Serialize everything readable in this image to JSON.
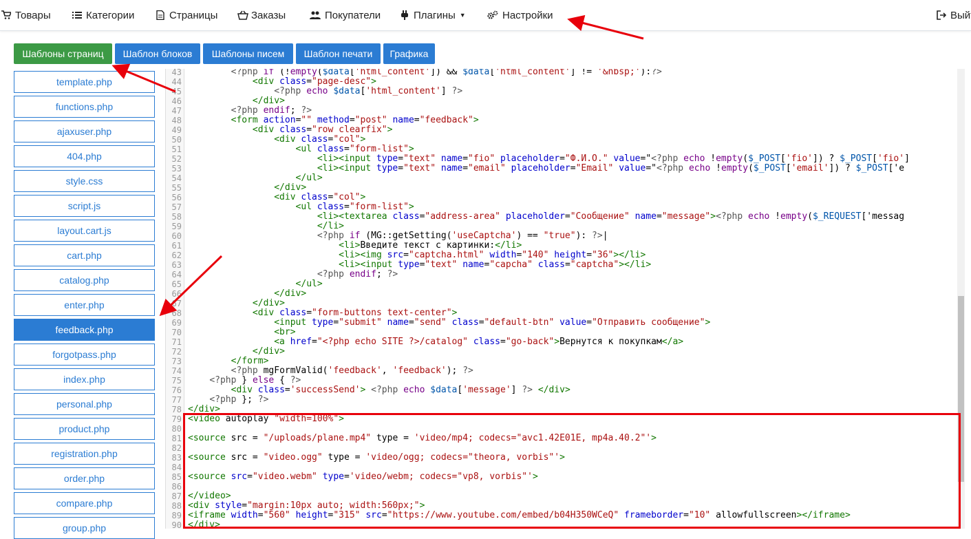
{
  "nav": {
    "items": [
      {
        "label": "Товары",
        "icon": "cart-icon"
      },
      {
        "label": "Категории",
        "icon": "list-icon"
      },
      {
        "label": "Страницы",
        "icon": "document-icon"
      },
      {
        "label": "Заказы",
        "icon": "basket-icon"
      },
      {
        "label": "Покупатели",
        "icon": "users-icon"
      },
      {
        "label": "Плагины",
        "icon": "plug-icon"
      },
      {
        "label": "Настройки",
        "icon": "gears-icon"
      }
    ],
    "exit_label": "Выйт"
  },
  "subtabs": [
    {
      "label": "Шаблоны страниц"
    },
    {
      "label": "Шаблон блоков"
    },
    {
      "label": "Шаблоны писем"
    },
    {
      "label": "Шаблон печати"
    },
    {
      "label": "Графика"
    }
  ],
  "files": [
    {
      "label": "template.php"
    },
    {
      "label": "functions.php"
    },
    {
      "label": "ajaxuser.php"
    },
    {
      "label": "404.php"
    },
    {
      "label": "style.css"
    },
    {
      "label": "script.js"
    },
    {
      "label": "layout.cart.js"
    },
    {
      "label": "cart.php"
    },
    {
      "label": "catalog.php"
    },
    {
      "label": "enter.php"
    },
    {
      "label": "feedback.php"
    },
    {
      "label": "forgotpass.php"
    },
    {
      "label": "index.php"
    },
    {
      "label": "personal.php"
    },
    {
      "label": "product.php"
    },
    {
      "label": "registration.php"
    },
    {
      "label": "order.php"
    },
    {
      "label": "compare.php"
    },
    {
      "label": "group.php"
    }
  ],
  "code": [
    {
      "n": "43",
      "t": "        <?php if (!empty($data['html_content']) && $data['html_content'] != '&nbsp;'):?>"
    },
    {
      "n": "44",
      "t": "            <div class=\"page-desc\">"
    },
    {
      "n": "45",
      "t": "                <?php echo $data['html_content'] ?>"
    },
    {
      "n": "46",
      "t": "            </div>"
    },
    {
      "n": "47",
      "t": "        <?php endif; ?>"
    },
    {
      "n": "48",
      "t": "        <form action=\"\" method=\"post\" name=\"feedback\">"
    },
    {
      "n": "49",
      "t": "            <div class=\"row clearfix\">"
    },
    {
      "n": "50",
      "t": "                <div class=\"col\">"
    },
    {
      "n": "51",
      "t": "                    <ul class=\"form-list\">"
    },
    {
      "n": "52",
      "t": "                        <li><input type=\"text\" name=\"fio\" placeholder=\"Ф.И.О.\" value=\"<?php echo !empty($_POST['fio']) ? $_POST['fio']"
    },
    {
      "n": "53",
      "t": "                        <li><input type=\"text\" name=\"email\" placeholder=\"Email\" value=\"<?php echo !empty($_POST['email']) ? $_POST['e"
    },
    {
      "n": "54",
      "t": "                    </ul>"
    },
    {
      "n": "55",
      "t": "                </div>"
    },
    {
      "n": "56",
      "t": "                <div class=\"col\">"
    },
    {
      "n": "57",
      "t": "                    <ul class=\"form-list\">"
    },
    {
      "n": "58",
      "t": "                        <li><textarea class=\"address-area\" placeholder=\"Сообщение\" name=\"message\"><?php echo !empty($_REQUEST['messag"
    },
    {
      "n": "59",
      "t": "                        </li>"
    },
    {
      "n": "60",
      "t": "                        <?php if (MG::getSetting('useCaptcha') == \"true\"): ?>|"
    },
    {
      "n": "61",
      "t": "                            <li>Введите текст с картинки:</li>"
    },
    {
      "n": "62",
      "t": "                            <li><img src=\"captcha.html\" width=\"140\" height=\"36\"></li>"
    },
    {
      "n": "63",
      "t": "                            <li><input type=\"text\" name=\"capcha\" class=\"captcha\"></li>"
    },
    {
      "n": "64",
      "t": "                        <?php endif; ?>"
    },
    {
      "n": "65",
      "t": "                    </ul>"
    },
    {
      "n": "66",
      "t": "                </div>"
    },
    {
      "n": "67",
      "t": "            </div>"
    },
    {
      "n": "68",
      "t": "            <div class=\"form-buttons text-center\">"
    },
    {
      "n": "69",
      "t": "                <input type=\"submit\" name=\"send\" class=\"default-btn\" value=\"Отправить сообщение\">"
    },
    {
      "n": "70",
      "t": "                <br>"
    },
    {
      "n": "71",
      "t": "                <a href=\"<?php echo SITE ?>/catalog\" class=\"go-back\">Вернутся к покупкам</a>"
    },
    {
      "n": "72",
      "t": "            </div>"
    },
    {
      "n": "73",
      "t": "        </form>"
    },
    {
      "n": "74",
      "t": "        <?php mgFormValid('feedback', 'feedback'); ?>"
    },
    {
      "n": "75",
      "t": "    <?php } else { ?>"
    },
    {
      "n": "76",
      "t": "        <div class='successSend'> <?php echo $data['message'] ?> </div>"
    },
    {
      "n": "77",
      "t": "    <?php }; ?>"
    },
    {
      "n": "78",
      "t": "</div>"
    },
    {
      "n": "79",
      "t": "<video autoplay \"width=100%\">"
    },
    {
      "n": "80",
      "t": ""
    },
    {
      "n": "81",
      "t": "<source src = \"/uploads/plane.mp4\" type = 'video/mp4; codecs=\"avc1.42E01E, mp4a.40.2\"'>"
    },
    {
      "n": "82",
      "t": ""
    },
    {
      "n": "83",
      "t": "<source src = \"video.ogg\" type = 'video/ogg; codecs=\"theora, vorbis\"'>"
    },
    {
      "n": "84",
      "t": ""
    },
    {
      "n": "85",
      "t": "<source src=\"video.webm\" type='video/webm; codecs=\"vp8, vorbis\"'>"
    },
    {
      "n": "86",
      "t": ""
    },
    {
      "n": "87",
      "t": "</video>"
    },
    {
      "n": "88",
      "t": "<div style=\"margin:10px auto; width:560px;\">"
    },
    {
      "n": "89",
      "t": "<iframe width=\"560\" height=\"315\" src=\"https://www.youtube.com/embed/b04H350WCeQ\" frameborder=\"10\" allowfullscreen></iframe>"
    },
    {
      "n": "90",
      "t": "</div>"
    }
  ],
  "colors": {
    "primary": "#2b7cd3",
    "active_tab": "#3c9a45",
    "annotation_red": "#e8000b"
  }
}
